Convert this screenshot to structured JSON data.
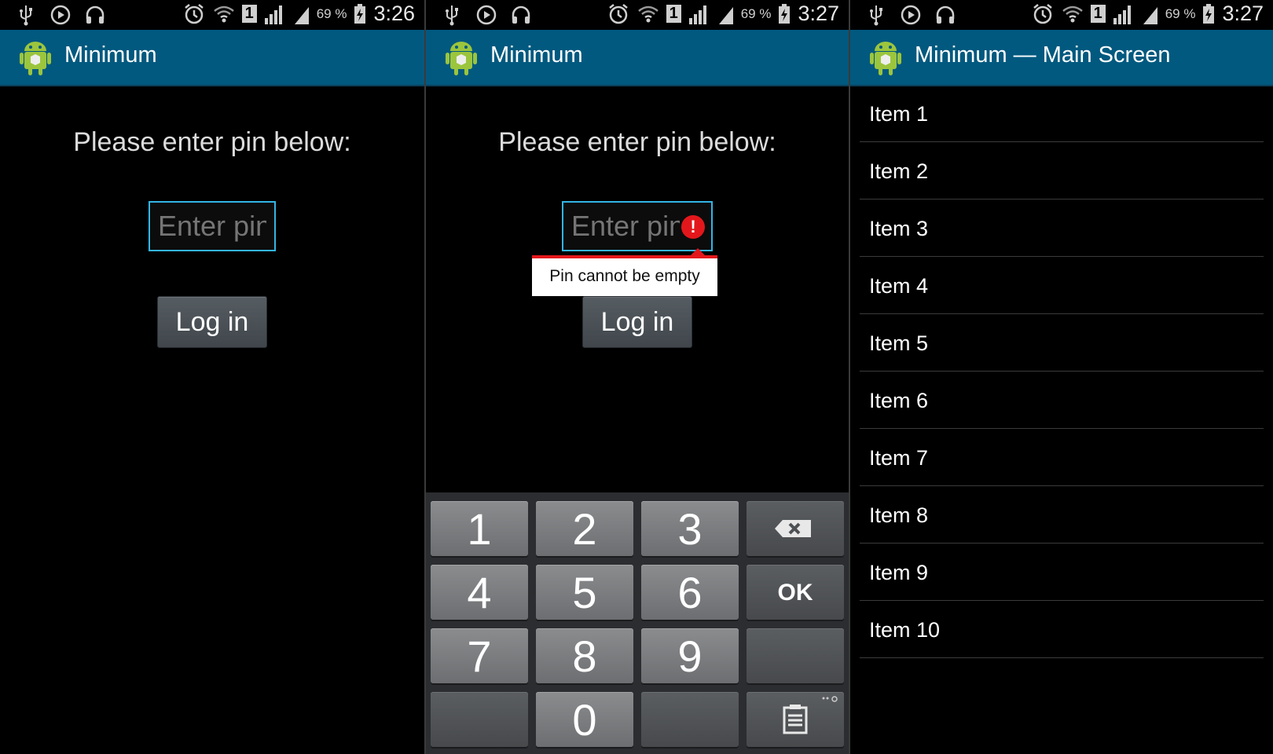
{
  "status_bars": [
    {
      "battery": "69 %",
      "time": "3:26",
      "sim": "1"
    },
    {
      "battery": "69 %",
      "time": "3:27",
      "sim": "1"
    },
    {
      "battery": "69 %",
      "time": "3:27",
      "sim": "1"
    }
  ],
  "login": {
    "app_title": "Minimum",
    "prompt": "Please enter pin below:",
    "pin_placeholder": "Enter pin",
    "login_label": "Log in"
  },
  "login_error": {
    "app_title": "Minimum",
    "prompt": "Please enter pin below:",
    "pin_placeholder": "Enter pin",
    "error_message": "Pin cannot be empty",
    "login_label": "Log in",
    "keypad": {
      "keys": [
        "1",
        "2",
        "3",
        "4",
        "5",
        "6",
        "7",
        "8",
        "9",
        "0"
      ],
      "ok_label": "OK"
    }
  },
  "main": {
    "app_title": "Minimum — Main Screen",
    "items": [
      "Item 1",
      "Item 2",
      "Item 3",
      "Item 4",
      "Item 5",
      "Item 6",
      "Item 7",
      "Item 8",
      "Item 9",
      "Item 10"
    ]
  },
  "colors": {
    "action_bar": "#01597f",
    "input_focus": "#33b5e5",
    "error": "#e3171b"
  },
  "icons": [
    "usb-icon",
    "play-icon",
    "headphones-icon",
    "alarm-icon",
    "wifi-icon",
    "signal-icon",
    "battery-charging-icon",
    "android-app-icon",
    "error-icon",
    "backspace-icon",
    "clipboard-icon"
  ]
}
